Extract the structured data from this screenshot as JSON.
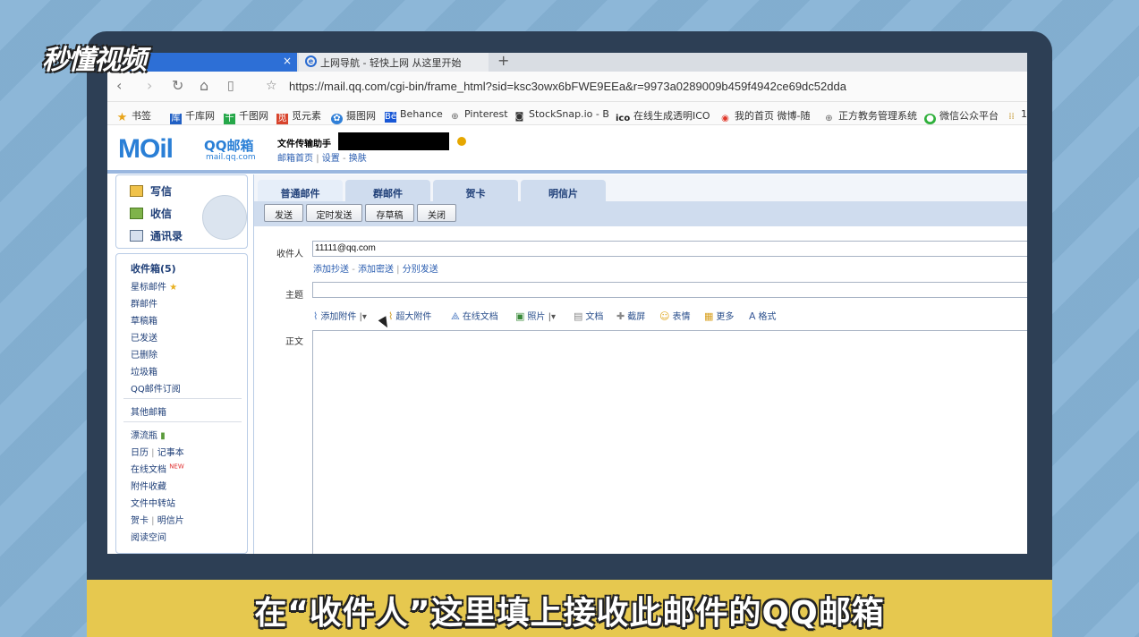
{
  "watermark": "秒懂视频",
  "browser": {
    "tabs": [
      {
        "label": "",
        "active": true,
        "close": "×"
      },
      {
        "label": "上网导航 - 轻快上网 从这里开始",
        "active": false
      }
    ],
    "new_tab": "+",
    "url": "https://mail.qq.com/cgi-bin/frame_html?sid=ksc3owx6bFWE9EEa&r=9973a0289009b459f4942ce69dc52dda",
    "bookmarks": [
      {
        "label": "书签",
        "icon": "star-icon"
      },
      {
        "label": "千库网",
        "icon": "qianku-icon"
      },
      {
        "label": "千图网",
        "icon": "qiantu-icon"
      },
      {
        "label": "觅元素",
        "icon": "miyuansu-icon"
      },
      {
        "label": "摄图网",
        "icon": "shetu-icon"
      },
      {
        "label": "Behance",
        "icon": "behance-icon"
      },
      {
        "label": "Pinterest",
        "icon": "globe-icon"
      },
      {
        "label": "StockSnap.io - B",
        "icon": "camera-icon"
      },
      {
        "label": "在线生成透明ICO",
        "icon": "ico-icon"
      },
      {
        "label": "我的首页 微博-随",
        "icon": "weibo-icon"
      },
      {
        "label": "正方教务管理系统",
        "icon": "globe-icon"
      },
      {
        "label": "微信公众平台",
        "icon": "wechat-icon"
      },
      {
        "label": "1",
        "icon": "misc-icon"
      }
    ]
  },
  "mail": {
    "logo_text": "MOil",
    "logo_name": "QQ邮箱",
    "logo_url": "mail.qq.com",
    "user_name": "文件传输助手",
    "user_links": [
      "邮箱首页",
      "设置",
      "换肤"
    ],
    "quick": [
      {
        "label": "写信",
        "icon": "compose-icon"
      },
      {
        "label": "收信",
        "icon": "inbox-download-icon"
      },
      {
        "label": "通讯录",
        "icon": "contacts-icon"
      }
    ],
    "folders": [
      "收件箱(5)",
      "星标邮件",
      "群邮件",
      "草稿箱",
      "已发送",
      "已删除",
      "垃圾箱",
      "QQ邮件订阅"
    ],
    "other_mail": "其他邮箱",
    "extras": [
      "漂流瓶",
      "日历",
      "记事本",
      "在线文档",
      "NEW",
      "附件收藏",
      "文件中转站",
      "贺卡",
      "明信片",
      "阅读空间"
    ],
    "compose_tabs": [
      "普通邮件",
      "群邮件",
      "贺卡",
      "明信片"
    ],
    "actions": [
      "发送",
      "定时发送",
      "存草稿",
      "关闭"
    ],
    "to_label": "收件人",
    "to_value": "11111@qq.com",
    "to_links": [
      "添加抄送",
      "添加密送",
      "分别发送"
    ],
    "subject_label": "主题",
    "subject_value": "",
    "tools": [
      "添加附件",
      "超大附件",
      "在线文档",
      "照片",
      "文档",
      "截屏",
      "表情",
      "更多",
      "格式"
    ],
    "body_label": "正文"
  },
  "caption": "在“收件人”这里填上接收此邮件的QQ邮箱"
}
